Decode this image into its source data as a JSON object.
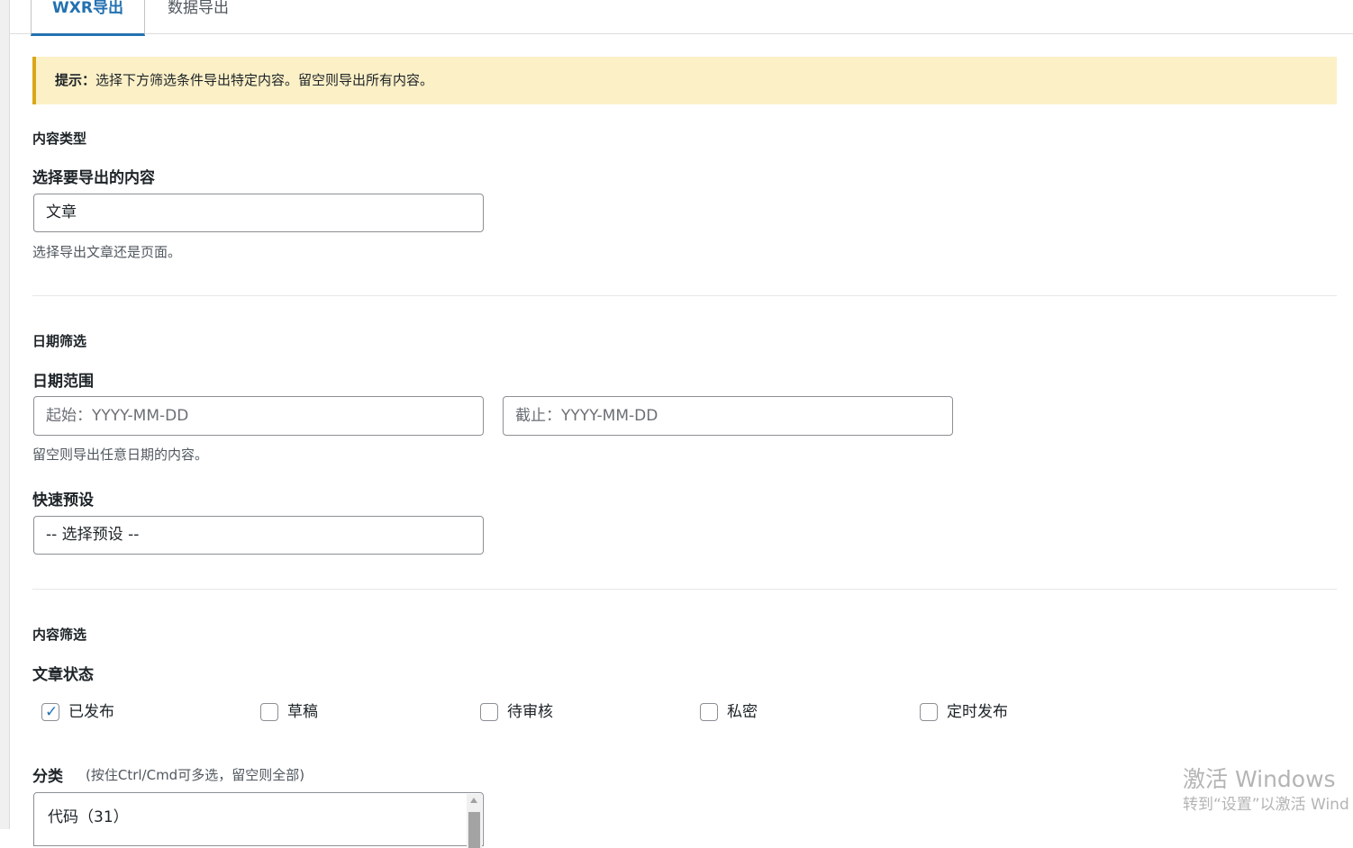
{
  "tabs": [
    {
      "label": "WXR导出",
      "active": true
    },
    {
      "label": "数据导出",
      "active": false
    }
  ],
  "notice": {
    "prefix": "提示：",
    "text": "选择下方筛选条件导出特定内容。留空则导出所有内容。"
  },
  "content_type": {
    "section_title": "内容类型",
    "label": "选择要导出的内容",
    "selected": "文章",
    "help": "选择导出文章还是页面。"
  },
  "date_filter": {
    "section_title": "日期筛选",
    "label": "日期范围",
    "start_placeholder": "起始：YYYY-MM-DD",
    "end_placeholder": "截止：YYYY-MM-DD",
    "help": "留空则导出任意日期的内容。",
    "preset_label": "快速预设",
    "preset_selected": "-- 选择预设 --"
  },
  "content_filter": {
    "section_title": "内容筛选",
    "status_label": "文章状态",
    "statuses": [
      {
        "label": "已发布",
        "checked": true
      },
      {
        "label": "草稿",
        "checked": false
      },
      {
        "label": "待审核",
        "checked": false
      },
      {
        "label": "私密",
        "checked": false
      },
      {
        "label": "定时发布",
        "checked": false
      }
    ],
    "category_label": "分类",
    "category_hint": "(按住Ctrl/Cmd可多选，留空则全部)",
    "categories": [
      "代码（31）"
    ]
  },
  "watermark": {
    "line1": "激活 Windows",
    "line2": "转到“设置”以激活 Wind"
  },
  "colors": {
    "accent": "#2271b1",
    "notice_bg": "#fcf0c7",
    "notice_border": "#dba617"
  }
}
